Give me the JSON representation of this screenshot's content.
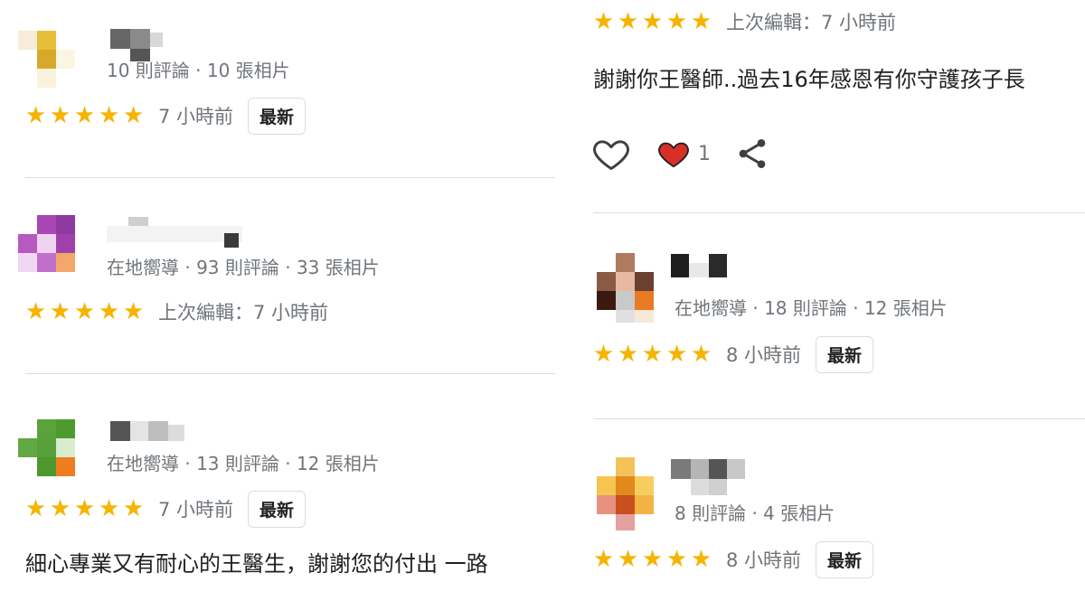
{
  "left": {
    "reviews": [
      {
        "meta": "10 則評論 · 10 張相片",
        "stars": [
          "★",
          "★",
          "★",
          "★",
          "★"
        ],
        "time": "7 小時前",
        "badge": "最新"
      },
      {
        "meta": "在地嚮導 · 93 則評論 · 33 張相片",
        "stars": [
          "★",
          "★",
          "★",
          "★",
          "★"
        ],
        "time": "上次編輯：7 小時前"
      },
      {
        "meta": "在地嚮導 · 13 則評論 · 12 張相片",
        "stars": [
          "★",
          "★",
          "★",
          "★",
          "★"
        ],
        "time": "7 小時前",
        "badge": "最新",
        "text": "細心專業又有耐心的王醫生，謝謝您的付出 一路"
      }
    ]
  },
  "right": {
    "top_review": {
      "stars": [
        "★",
        "★",
        "★",
        "★",
        "★"
      ],
      "time": "上次編輯：7 小時前",
      "text": "謝謝你王醫師..過去16年感恩有你守護孩子長",
      "like_icon": "heart-outline-icon",
      "reaction_icon": "heart-filled-icon",
      "reaction_count": "1",
      "share_icon": "share-icon"
    },
    "reviews": [
      {
        "meta": "在地嚮導 · 18 則評論 · 12 張相片",
        "stars": [
          "★",
          "★",
          "★",
          "★",
          "★"
        ],
        "time": "8 小時前",
        "badge": "最新"
      },
      {
        "meta": "8 則評論 · 4 張相片",
        "stars": [
          "★",
          "★",
          "★",
          "★",
          "★"
        ],
        "time": "8 小時前",
        "badge": "最新"
      }
    ]
  },
  "colors": {
    "star": "#f4b400",
    "heart": "#d93025",
    "text": "#202124",
    "muted": "#70757a",
    "divider": "#dadce0"
  }
}
